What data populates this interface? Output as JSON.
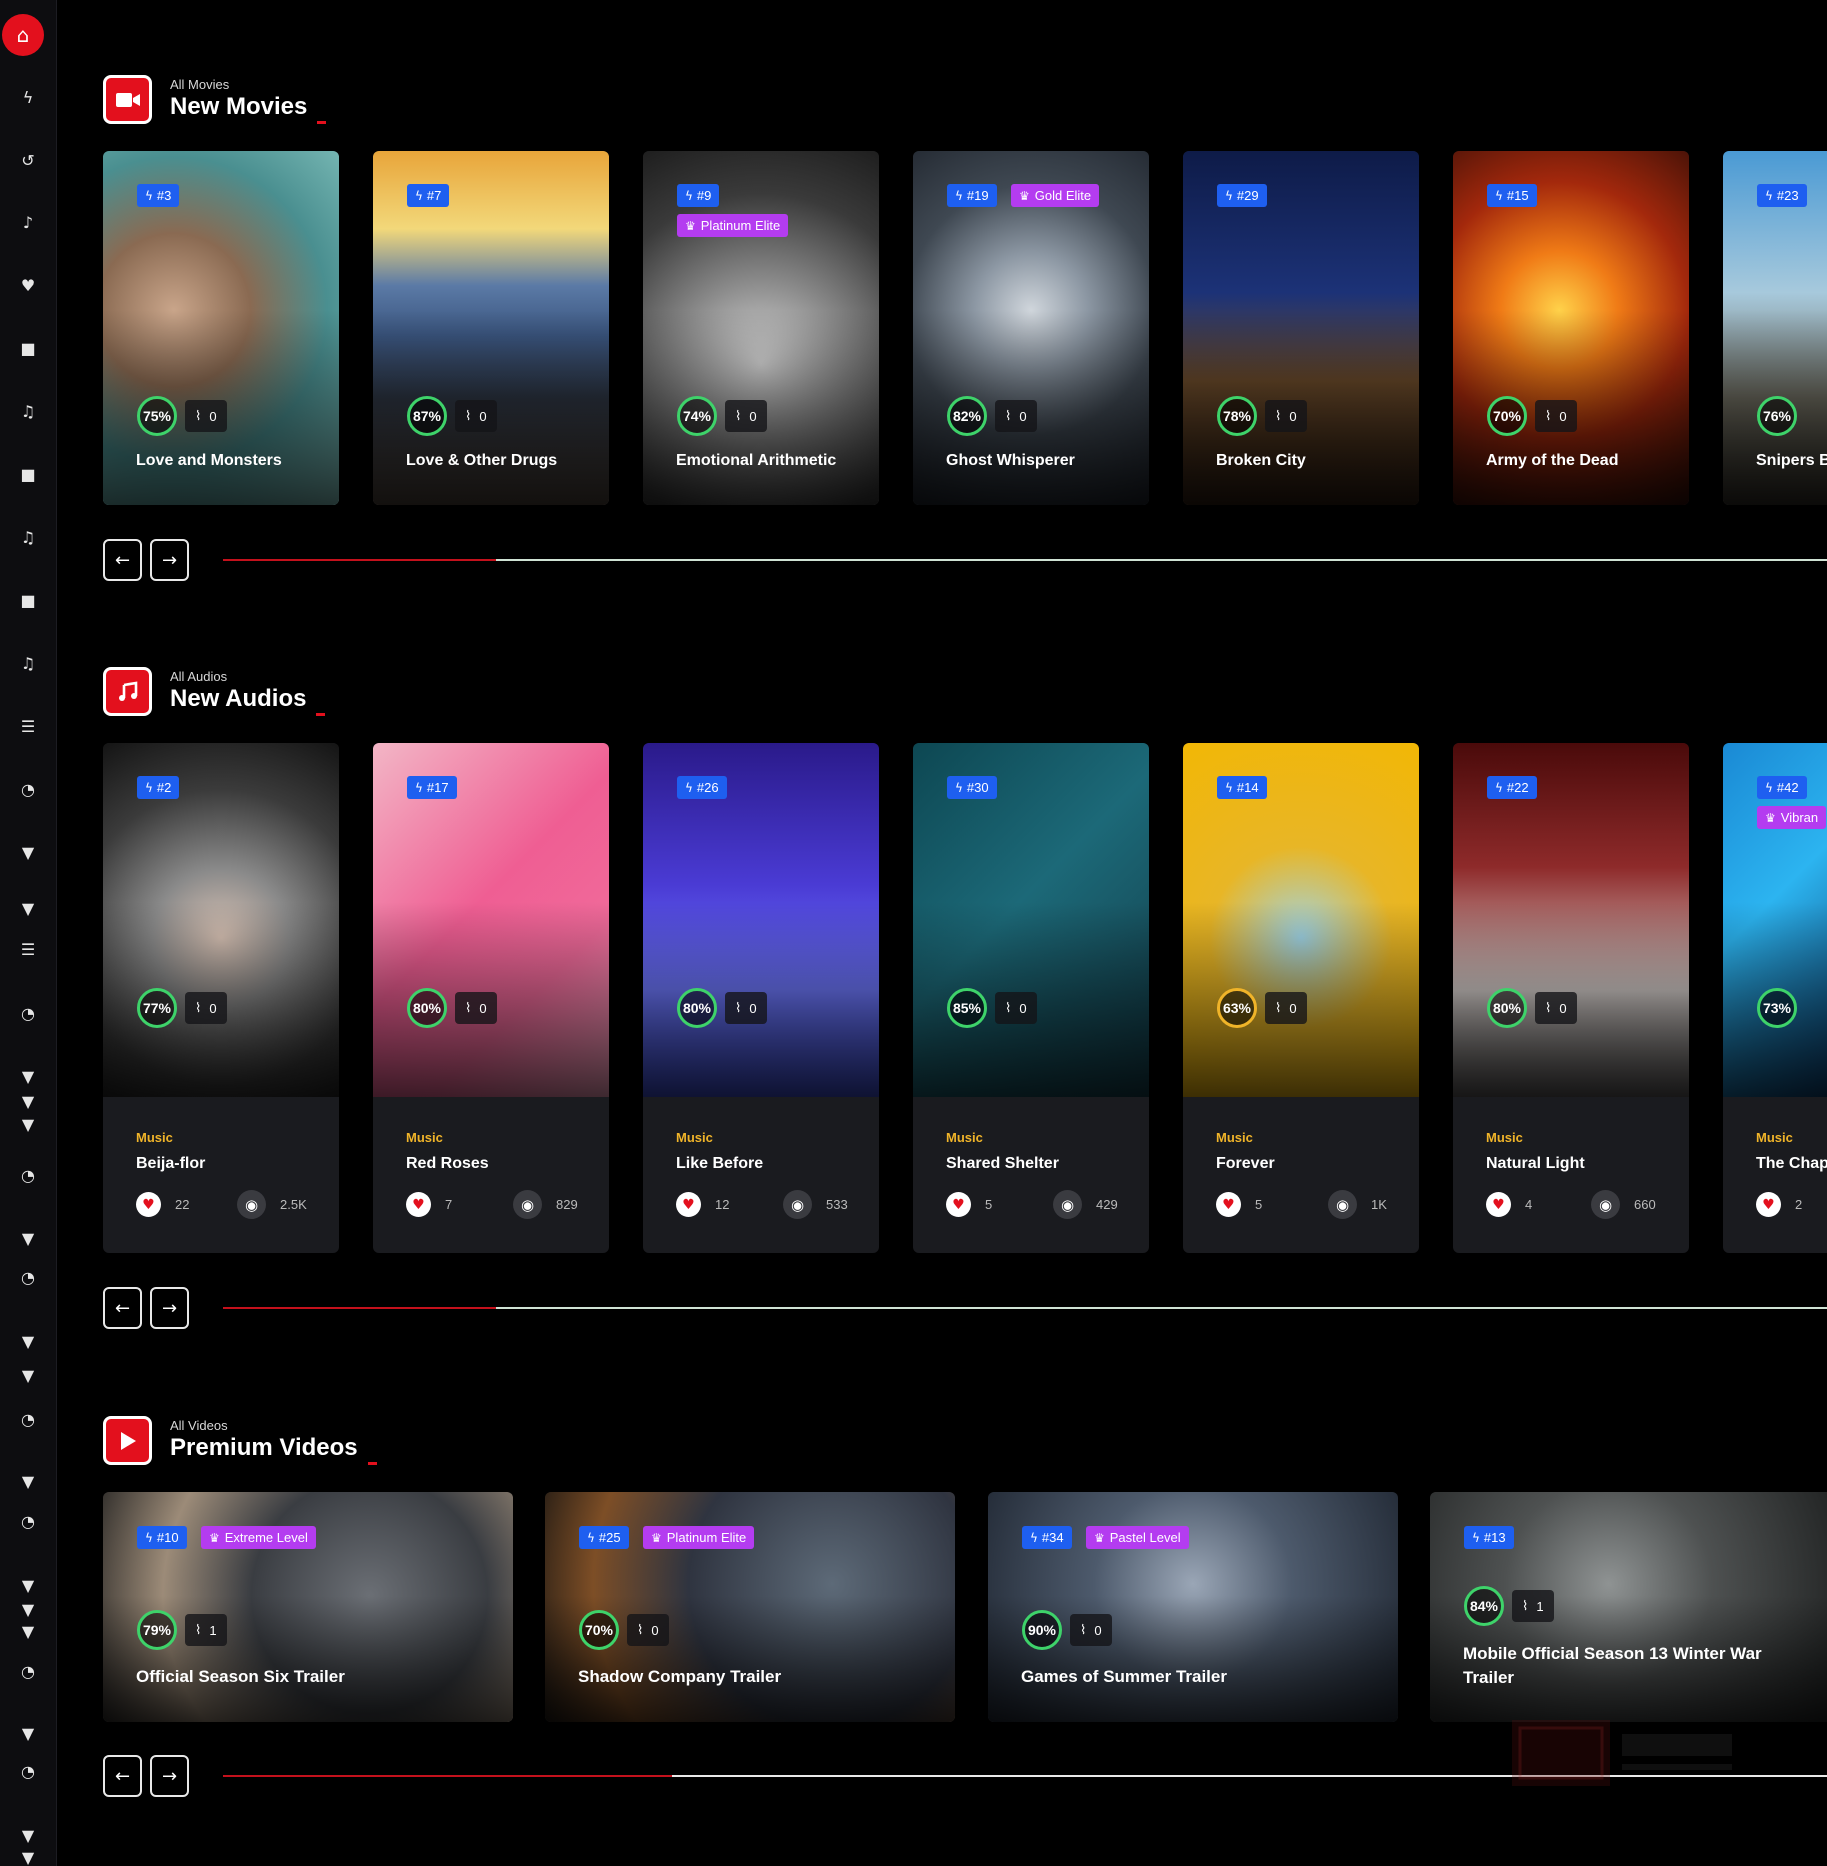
{
  "sidebar": {
    "icons": [
      "home-icon",
      "bolt-icon",
      "history-icon",
      "bell-icon",
      "heart-icon",
      "video-icon",
      "music-icon",
      "video-icon",
      "music-icon",
      "video-icon",
      "music-icon",
      "list-icon",
      "podcast-icon",
      "filter-icon",
      "filter-icon",
      "list-icon",
      "podcast-icon",
      "filter-icon",
      "filter-icon",
      "filter-icon",
      "podcast-icon",
      "filter-icon",
      "podcast-icon",
      "filter-icon",
      "filter-icon",
      "podcast-icon",
      "filter-icon",
      "podcast-icon",
      "filter-icon",
      "filter-icon",
      "filter-icon",
      "podcast-icon",
      "filter-icon",
      "podcast-icon",
      "filter-icon",
      "filter-icon"
    ]
  },
  "sections": [
    {
      "id": "movies",
      "icon": "video-camera-icon",
      "subtitle": "All Movies",
      "title": "New Movies",
      "progress": 0.17,
      "cards": [
        {
          "rank": "#3",
          "elite": "",
          "score": "75%",
          "trend": "0",
          "title": "Love and Monsters"
        },
        {
          "rank": "#7",
          "elite": "",
          "score": "87%",
          "trend": "0",
          "title": "Love & Other Drugs"
        },
        {
          "rank": "#9",
          "elite": "Platinum Elite",
          "score": "74%",
          "trend": "0",
          "title": "Emotional Arithmetic"
        },
        {
          "rank": "#19",
          "elite": "Gold Elite",
          "score": "82%",
          "trend": "0",
          "title": "Ghost Whisperer"
        },
        {
          "rank": "#29",
          "elite": "",
          "score": "78%",
          "trend": "0",
          "title": "Broken City"
        },
        {
          "rank": "#15",
          "elite": "",
          "score": "70%",
          "trend": "0",
          "title": "Army of the Dead"
        },
        {
          "rank": "#23",
          "elite": "",
          "score": "76%",
          "trend": "",
          "title": "Snipers B"
        }
      ]
    },
    {
      "id": "audios",
      "icon": "music-note-icon",
      "subtitle": "All Audios",
      "title": "New Audios",
      "progress": 0.17,
      "cards": [
        {
          "rank": "#2",
          "elite": "",
          "score": "77%",
          "trend": "0",
          "genre": "Music",
          "title": "Beija-flor",
          "likes": "22",
          "views": "2.5K"
        },
        {
          "rank": "#17",
          "elite": "",
          "score": "80%",
          "trend": "0",
          "genre": "Music",
          "title": "Red Roses",
          "likes": "7",
          "views": "829"
        },
        {
          "rank": "#26",
          "elite": "",
          "score": "80%",
          "trend": "0",
          "genre": "Music",
          "title": "Like Before",
          "likes": "12",
          "views": "533"
        },
        {
          "rank": "#30",
          "elite": "",
          "score": "85%",
          "trend": "0",
          "genre": "Music",
          "title": "Shared Shelter",
          "likes": "5",
          "views": "429"
        },
        {
          "rank": "#14",
          "elite": "",
          "score": "63%",
          "trend": "0",
          "genre": "Music",
          "title": "Forever",
          "likes": "5",
          "views": "1K"
        },
        {
          "rank": "#22",
          "elite": "",
          "score": "80%",
          "trend": "0",
          "genre": "Music",
          "title": "Natural Light",
          "likes": "4",
          "views": "660"
        },
        {
          "rank": "#42",
          "elite": "Vibran",
          "score": "73%",
          "trend": "",
          "genre": "Music",
          "title": "The Chap",
          "likes": "2",
          "views": ""
        }
      ]
    },
    {
      "id": "videos",
      "icon": "play-icon",
      "subtitle": "All Videos",
      "title": "Premium Videos",
      "progress": 0.28,
      "cards": [
        {
          "rank": "#10",
          "elite": "Extreme Level",
          "score": "79%",
          "trend": "1",
          "title": "Official Season Six Trailer"
        },
        {
          "rank": "#25",
          "elite": "Platinum Elite",
          "score": "70%",
          "trend": "0",
          "title": "Shadow Company Trailer"
        },
        {
          "rank": "#34",
          "elite": "Pastel Level",
          "score": "90%",
          "trend": "0",
          "title": "Games of Summer Trailer"
        },
        {
          "rank": "#13",
          "elite": "",
          "score": "84%",
          "trend": "1",
          "title": "Mobile Official Season 13 Winter War Trailer"
        }
      ]
    }
  ],
  "nav": {
    "prev": "←",
    "next": "→"
  },
  "colors": {
    "accent": "#e3101d",
    "rank": "#1e5ff0",
    "elite": "#b43cf0",
    "score_ring": "#3ed36a",
    "genre": "#f0b429"
  }
}
